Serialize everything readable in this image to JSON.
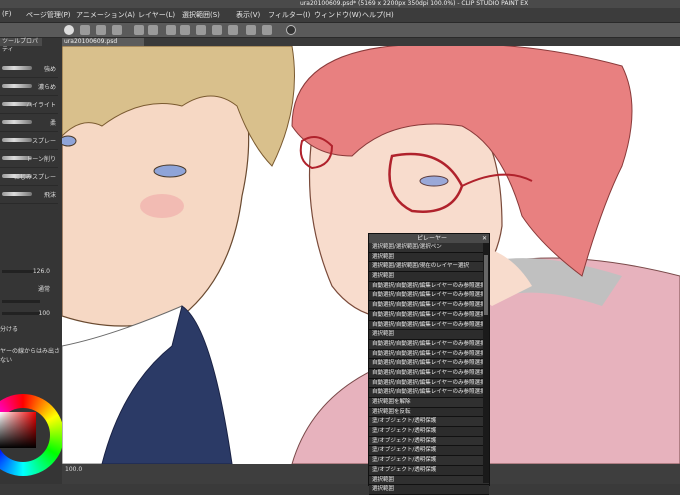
{
  "window": {
    "title": "ura20100609.psd* (5169 x 2200px 350dpi 100.0%) - CLIP STUDIO PAINT EX"
  },
  "menu": [
    "(F)",
    "ページ管理(P)",
    "アニメーション(A)",
    "レイヤー(L)",
    "選択範囲(S)",
    "表示(V)",
    "フィルター(I)",
    "ウィンドウ(W)",
    "ヘルプ(H)"
  ],
  "left_panel": {
    "tab": "ツールプロパティ",
    "brushes": [
      "強め",
      "濃らめ",
      "ハイライト",
      "柔",
      "スプレー",
      "トーン削り",
      "にじみスプレー",
      "飛沫"
    ],
    "props": [
      {
        "value": "126.0"
      },
      {
        "value": "通常"
      },
      {
        "value": ""
      },
      {
        "value": "100"
      },
      {
        "value": "分ける"
      },
      {
        "value": "ヤーの線からはみ出さない"
      }
    ]
  },
  "document_tab": "ura20100609.psd",
  "statusbar": {
    "zoom": "100.0"
  },
  "layer_panel": {
    "title": "ピレーヤー",
    "rows": [
      "選択範囲/選択範囲/選択ペン",
      "選択範囲",
      "選択範囲/選択範囲/現在のレイヤー選択",
      "選択範囲",
      "自動選択/自動選択/編集レイヤーのみ参照選択",
      "自動選択/自動選択/編集レイヤーのみ参照選択",
      "自動選択/自動選択/編集レイヤーのみ参照選択",
      "自動選択/自動選択/編集レイヤーのみ参照選択",
      "自動選択/自動選択/編集レイヤーのみ参照選択",
      "選択範囲",
      "自動選択/自動選択/編集レイヤーのみ参照選択",
      "自動選択/自動選択/編集レイヤーのみ参照選択",
      "自動選択/自動選択/編集レイヤーのみ参照選択",
      "自動選択/自動選択/編集レイヤーのみ参照選択",
      "自動選択/自動選択/編集レイヤーのみ参照選択",
      "自動選択/自動選択/編集レイヤーのみ参照選択",
      "選択範囲を解除",
      "選択範囲を反転",
      "塗/オブジェクト/透明保護",
      "塗/オブジェクト/透明保護",
      "塗/オブジェクト/透明保護",
      "塗/オブジェクト/透明保護",
      "塗/オブジェクト/透明保護",
      "塗/オブジェクト/透明保護",
      "選択範囲",
      "選択範囲"
    ]
  },
  "colors": {
    "skin_left": "#f6d8c4",
    "hair_left": "#d9c08c",
    "hair_right": "#e88080",
    "jacket": "#2b3a66",
    "sweater": "#e7b2bd",
    "glasses": "#b0222c"
  }
}
